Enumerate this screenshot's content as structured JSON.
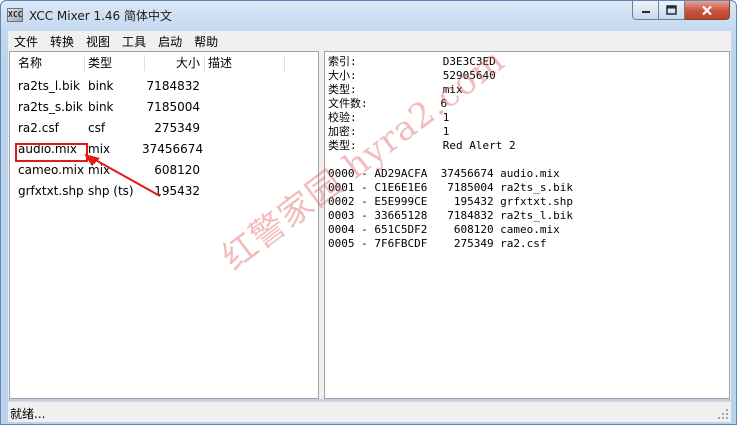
{
  "window": {
    "title": "XCC Mixer 1.46 简体中文",
    "app_icon_text": "XCC"
  },
  "menu": [
    "文件",
    "转换",
    "视图",
    "工具",
    "启动",
    "帮助"
  ],
  "list": {
    "columns": {
      "name": "名称",
      "type": "类型",
      "size": "大小",
      "description": "描述"
    },
    "rows": [
      {
        "name": "ra2ts_l.bik",
        "type": "bink",
        "size": "7184832"
      },
      {
        "name": "ra2ts_s.bik",
        "type": "bink",
        "size": "7185004"
      },
      {
        "name": "ra2.csf",
        "type": "csf",
        "size": "275349"
      },
      {
        "name": "audio.mix",
        "type": "mix",
        "size": "37456674"
      },
      {
        "name": "cameo.mix",
        "type": "mix",
        "size": "608120"
      },
      {
        "name": "grfxtxt.shp",
        "type": "shp (ts)",
        "size": "195432"
      }
    ],
    "highlighted_row": "audio.mix"
  },
  "info_pane": {
    "lines": [
      "索引:             D3E3C3ED",
      "大小:             52905640",
      "类型:             mix",
      "文件数:           6",
      "校验:             1",
      "加密:             1",
      "类型:             Red Alert 2",
      "",
      "0000 - AD29ACFA  37456674 audio.mix",
      "0001 - C1E6E1E6   7185004 ra2ts_s.bik",
      "0002 - E5E999CE    195432 grfxtxt.shp",
      "0003 - 33665128   7184832 ra2ts_l.bik",
      "0004 - 651C5DF2    608120 cameo.mix",
      "0005 - 7F6FBCDF    275349 ra2.csf"
    ]
  },
  "status": {
    "text": "就绪..."
  },
  "watermark": "红警家园 hyra2.com",
  "colors": {
    "highlight": "#e11b1b",
    "watermark": "#e26060",
    "frame": "#bcd2ec"
  }
}
